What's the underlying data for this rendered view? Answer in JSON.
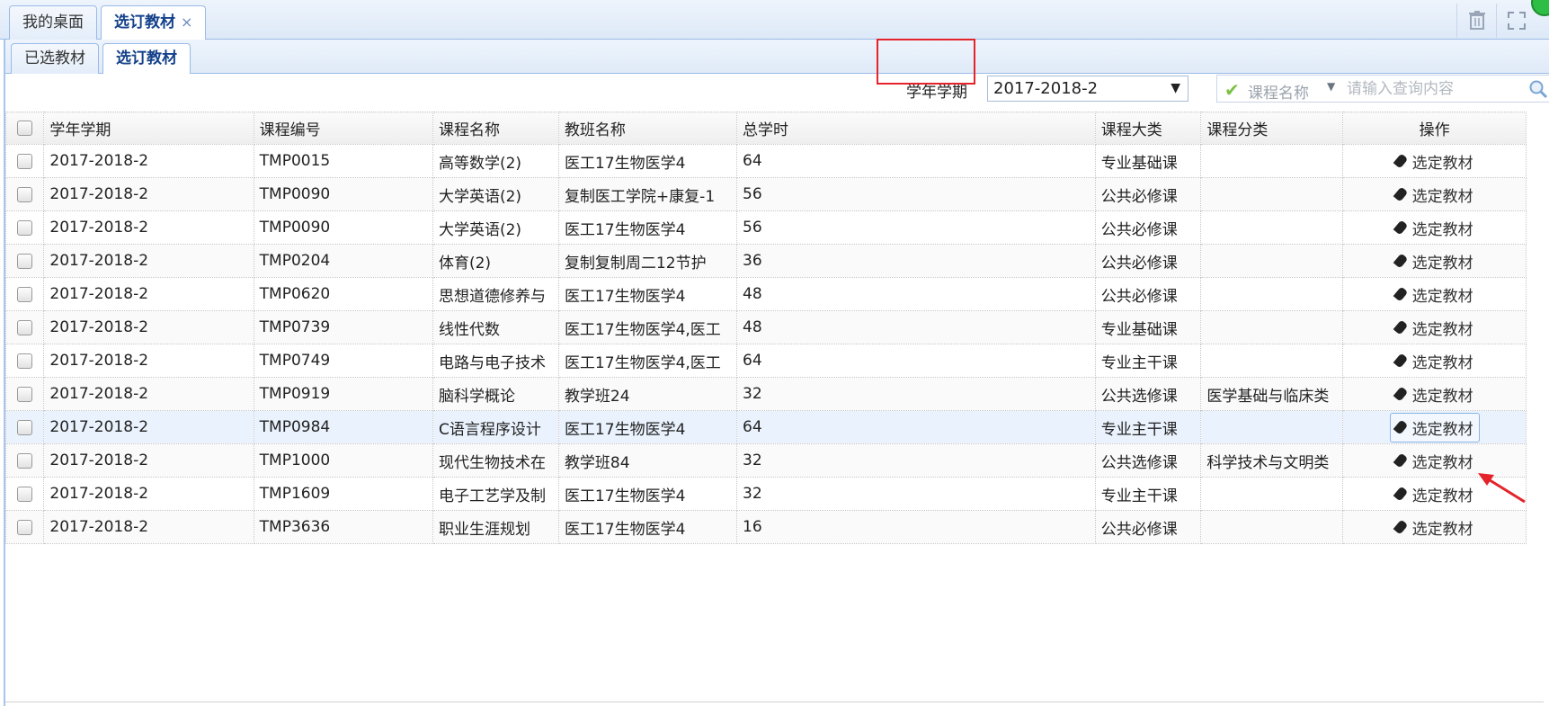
{
  "outer_tabs": [
    {
      "label": "我的桌面"
    },
    {
      "label": "选订教材",
      "close": "×"
    }
  ],
  "inner_tabs": [
    {
      "label": "已选教材"
    },
    {
      "label": "选订教材"
    }
  ],
  "toolbar": {
    "term_label": "学年学期",
    "term_value": "2017-2018-2",
    "search_field": "课程名称",
    "search_placeholder": "请输入查询内容"
  },
  "table": {
    "columns": [
      "学年学期",
      "课程编号",
      "课程名称",
      "教班名称",
      "总学时",
      "课程大类",
      "课程分类",
      "操作"
    ],
    "rows": [
      {
        "term": "2017-2018-2",
        "code": "TMP0015",
        "name": "高等数学(2)",
        "class": "医工17生物医学4",
        "hours": "64",
        "category": "专业基础课",
        "subcategory": "",
        "action": "选定教材"
      },
      {
        "term": "2017-2018-2",
        "code": "TMP0090",
        "name": "大学英语(2)",
        "class": "复制医工学院+康复-1",
        "hours": "56",
        "category": "公共必修课",
        "subcategory": "",
        "action": "选定教材"
      },
      {
        "term": "2017-2018-2",
        "code": "TMP0090",
        "name": "大学英语(2)",
        "class": "医工17生物医学4",
        "hours": "56",
        "category": "公共必修课",
        "subcategory": "",
        "action": "选定教材"
      },
      {
        "term": "2017-2018-2",
        "code": "TMP0204",
        "name": "体育(2)",
        "class": "复制复制周二12节护",
        "hours": "36",
        "category": "公共必修课",
        "subcategory": "",
        "action": "选定教材"
      },
      {
        "term": "2017-2018-2",
        "code": "TMP0620",
        "name": "思想道德修养与",
        "class": "医工17生物医学4",
        "hours": "48",
        "category": "公共必修课",
        "subcategory": "",
        "action": "选定教材"
      },
      {
        "term": "2017-2018-2",
        "code": "TMP0739",
        "name": "线性代数",
        "class": "医工17生物医学4,医工",
        "hours": "48",
        "category": "专业基础课",
        "subcategory": "",
        "action": "选定教材"
      },
      {
        "term": "2017-2018-2",
        "code": "TMP0749",
        "name": "电路与电子技术",
        "class": "医工17生物医学4,医工",
        "hours": "64",
        "category": "专业主干课",
        "subcategory": "",
        "action": "选定教材"
      },
      {
        "term": "2017-2018-2",
        "code": "TMP0919",
        "name": "脑科学概论",
        "class": "教学班24",
        "hours": "32",
        "category": "公共选修课",
        "subcategory": "医学基础与临床类",
        "action": "选定教材"
      },
      {
        "term": "2017-2018-2",
        "code": "TMP0984",
        "name": "C语言程序设计",
        "class": "医工17生物医学4",
        "hours": "64",
        "category": "专业主干课",
        "subcategory": "",
        "action": "选定教材"
      },
      {
        "term": "2017-2018-2",
        "code": "TMP1000",
        "name": "现代生物技术在",
        "class": "教学班84",
        "hours": "32",
        "category": "公共选修课",
        "subcategory": "科学技术与文明类",
        "action": "选定教材"
      },
      {
        "term": "2017-2018-2",
        "code": "TMP1609",
        "name": "电子工艺学及制",
        "class": "医工17生物医学4",
        "hours": "32",
        "category": "专业主干课",
        "subcategory": "",
        "action": "选定教材"
      },
      {
        "term": "2017-2018-2",
        "code": "TMP3636",
        "name": "职业生涯规划",
        "class": "医工17生物医学4",
        "hours": "16",
        "category": "公共必修课",
        "subcategory": "",
        "action": "选定教材"
      }
    ]
  },
  "colors": {
    "accent": "#15428b",
    "tab_border": "#99bbe8",
    "highlight": "#e5232a",
    "row_hover": "#eaf2fd"
  },
  "icons": [
    "trash-icon",
    "fullscreen-icon",
    "check-icon",
    "caret-down-icon",
    "search-icon",
    "pencil-icon",
    "arrow-annotation-icon"
  ]
}
